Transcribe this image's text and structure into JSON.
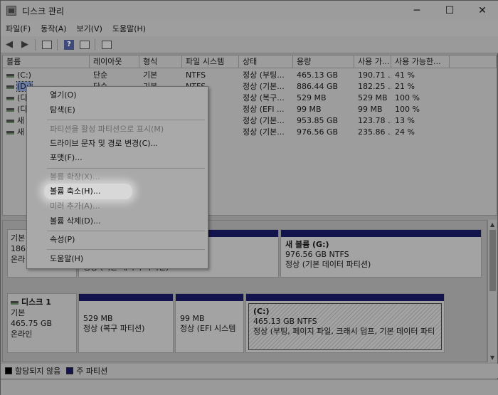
{
  "window": {
    "title": "디스크 관리",
    "minimize": "─",
    "maximize": "☐",
    "close": "✕"
  },
  "menu": [
    "파일(F)",
    "동작(A)",
    "보기(V)",
    "도움말(H)"
  ],
  "toolbar": {
    "icons": [
      "back-icon",
      "forward-icon",
      "disk-list-icon",
      "help-icon",
      "properties-icon",
      "settings-icon"
    ]
  },
  "volume_table": {
    "headers": [
      "볼륨",
      "레이아웃",
      "형식",
      "파일 시스템",
      "상태",
      "용량",
      "사용 가...",
      "사용 가능한...",
      ""
    ],
    "rows": [
      [
        "(C:)",
        "단순",
        "기본",
        "NTFS",
        "정상 (부팅...",
        "465.13 GB",
        "190.71 ...",
        "41 %"
      ],
      [
        "(D:)",
        "단순",
        "기본",
        "NTFS",
        "정상 (기본...",
        "886.44 GB",
        "182.25 ...",
        "21 %"
      ],
      [
        "(디",
        "",
        "",
        "",
        "정상 (복구...",
        "529 MB",
        "529 MB",
        "100 %"
      ],
      [
        "(디",
        "",
        "",
        "",
        "정상 (EFI ...",
        "99 MB",
        "99 MB",
        "100 %"
      ],
      [
        "새",
        "",
        "",
        "",
        "정상 (기본...",
        "953.85 GB",
        "123.78 ...",
        "13 %"
      ],
      [
        "새",
        "",
        "",
        "",
        "정상 (기본...",
        "976.56 GB",
        "235.86 ...",
        "24 %"
      ]
    ]
  },
  "disk0": {
    "type": "기본",
    "size": "1863",
    "status": "온라",
    "partitions": [
      {
        "title": "새 볼륨  (G:)",
        "size": "976.56 GB NTFS",
        "status": "정상 (기본 데이터 파티션)"
      },
      {
        "fragment": "정상 (기본 데이터 파티션)"
      }
    ]
  },
  "disk1": {
    "name": "디스크 1",
    "type": "기본",
    "size": "465.75 GB",
    "status": "온라인",
    "partitions": [
      {
        "size": "529 MB",
        "status": "정상 (복구 파티션)"
      },
      {
        "size": "99 MB",
        "status": "정상 (EFI 시스템"
      },
      {
        "title": "(C:)",
        "size": "465.13 GB NTFS",
        "status": "정상 (부팅, 페이지 파일, 크래시 덤프, 기본 데이터 파티"
      }
    ]
  },
  "legend": [
    "할당되지 않음",
    "주 파티션"
  ],
  "colors": {
    "primary_partition": "#13134d",
    "unallocated": "#000000"
  },
  "context_menu": {
    "items": [
      {
        "label": "열기(O)",
        "enabled": true
      },
      {
        "label": "탐색(E)",
        "enabled": true
      },
      {
        "label": "파티션을 활성 파티션으로 표시(M)",
        "enabled": false
      },
      {
        "label": "드라이브 문자 및 경로 변경(C)...",
        "enabled": true
      },
      {
        "label": "포맷(F)...",
        "enabled": true
      },
      {
        "label": "볼륨 확장(X)...",
        "enabled": false
      },
      {
        "label": "볼륨 축소(H)...",
        "enabled": true,
        "highlighted": true
      },
      {
        "label": "미러 추가(A)...",
        "enabled": false
      },
      {
        "label": "볼륨 삭제(D)...",
        "enabled": true
      },
      {
        "label": "속성(P)",
        "enabled": true
      },
      {
        "label": "도움말(H)",
        "enabled": true
      }
    ]
  }
}
